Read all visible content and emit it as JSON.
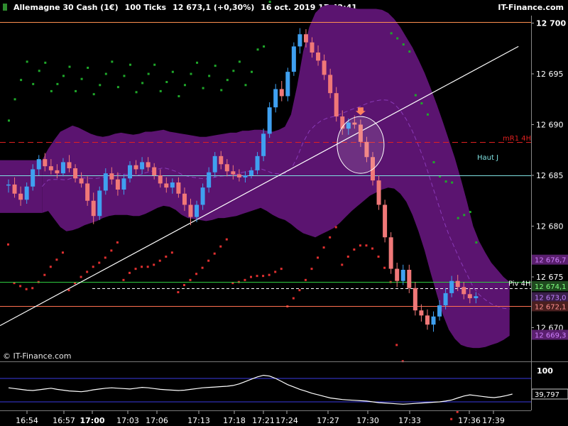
{
  "header": {
    "instrument": "Allemagne 30 Cash (1€)",
    "ticks": "100 Ticks",
    "last": "12 673,1 (+0,30%)",
    "datetime": "16 oct. 2019 17:42:41",
    "brand": "IT-Finance.com"
  },
  "watermark": "© IT-Finance.com",
  "chart_data": [
    {
      "type": "candlestick",
      "ylim": [
        12668,
        12702
      ],
      "y_ticks": [
        {
          "value": 12700,
          "label": "12 700"
        },
        {
          "value": 12695,
          "label": "12 695"
        },
        {
          "value": 12690,
          "label": "12 690"
        },
        {
          "value": 12685,
          "label": "12 685"
        },
        {
          "value": 12680,
          "label": "12 680"
        },
        {
          "value": 12675,
          "label": "12 675"
        },
        {
          "value": 12670,
          "label": "12 670"
        }
      ],
      "x_labels": [
        "16:54",
        "16:57",
        "17:00",
        "17:03",
        "17:06",
        "17:13",
        "17:18",
        "17:21",
        "17:24",
        "17:27",
        "17:30",
        "17:33",
        "17:36",
        "17:39"
      ],
      "bold_x_label": "17:00",
      "levels": [
        {
          "name": "mR1 4H",
          "value": 12688.3,
          "color": "#e02020",
          "style": "dashed"
        },
        {
          "name": "Haut J",
          "value": 12685.0,
          "color": "#7fe0e0",
          "style": "solid"
        },
        {
          "name": "Piv 4H",
          "value": 12673.9,
          "color": "#ffffff",
          "style": "dashed"
        },
        {
          "name": "",
          "value": 12674.5,
          "color": "#2ecc40",
          "style": "solid"
        },
        {
          "name": "",
          "value": 12672.1,
          "color": "#ff7050",
          "style": "solid"
        },
        {
          "name": "",
          "value": 12700.1,
          "color": "#ff9050",
          "style": "solid"
        }
      ],
      "price_tags": [
        {
          "label": "12 676,7",
          "value": 12676.7,
          "bg": "#5a1f6e",
          "fg": "#d080ff"
        },
        {
          "label": "12 674,1",
          "value": 12674.1,
          "bg": "#1f4a1f",
          "fg": "#7fff7f"
        },
        {
          "label": "12 673,0",
          "value": 12673.0,
          "bg": "#3a1f4a",
          "fg": "#c080ff"
        },
        {
          "label": "12 672,1",
          "value": 12672.1,
          "bg": "#4a1f1f",
          "fg": "#ff9090"
        },
        {
          "label": "12 669,3",
          "value": 12669.3,
          "bg": "#5a1f6e",
          "fg": "#d080ff"
        }
      ],
      "candles": [
        [
          12684.0,
          12684.6,
          12683.3,
          12684.1
        ],
        [
          12684.1,
          12684.8,
          12682.8,
          12683.2
        ],
        [
          12683.2,
          12683.9,
          12682.0,
          12682.6
        ],
        [
          12682.6,
          12684.3,
          12682.2,
          12683.9
        ],
        [
          12683.9,
          12686.1,
          12683.5,
          12685.6
        ],
        [
          12685.6,
          12687.0,
          12685.0,
          12686.6
        ],
        [
          12686.6,
          12687.2,
          12685.4,
          12685.9
        ],
        [
          12685.9,
          12686.6,
          12685.1,
          12685.5
        ],
        [
          12685.5,
          12686.1,
          12684.7,
          12685.2
        ],
        [
          12685.2,
          12686.7,
          12684.9,
          12686.3
        ],
        [
          12686.3,
          12687.0,
          12685.3,
          12685.7
        ],
        [
          12685.7,
          12686.1,
          12684.3,
          12684.7
        ],
        [
          12684.7,
          12685.3,
          12683.8,
          12684.2
        ],
        [
          12684.2,
          12684.9,
          12682.0,
          12682.5
        ],
        [
          12682.5,
          12683.3,
          12680.2,
          12681.0
        ],
        [
          12681.0,
          12683.9,
          12680.6,
          12683.5
        ],
        [
          12683.5,
          12685.7,
          12683.1,
          12685.2
        ],
        [
          12685.2,
          12685.8,
          12684.1,
          12684.6
        ],
        [
          12684.6,
          12685.3,
          12683.0,
          12683.6
        ],
        [
          12683.6,
          12685.1,
          12683.1,
          12684.7
        ],
        [
          12684.7,
          12686.4,
          12684.3,
          12686.0
        ],
        [
          12686.0,
          12686.5,
          12685.1,
          12685.6
        ],
        [
          12685.6,
          12686.8,
          12685.1,
          12686.3
        ],
        [
          12686.3,
          12686.8,
          12685.4,
          12685.8
        ],
        [
          12685.8,
          12686.2,
          12684.6,
          12685.0
        ],
        [
          12685.0,
          12685.6,
          12683.8,
          12684.2
        ],
        [
          12684.2,
          12684.8,
          12683.3,
          12683.8
        ],
        [
          12683.8,
          12684.7,
          12683.2,
          12684.3
        ],
        [
          12684.3,
          12684.8,
          12682.8,
          12683.2
        ],
        [
          12683.2,
          12683.8,
          12681.5,
          12682.1
        ],
        [
          12682.1,
          12682.7,
          12680.1,
          12680.9
        ],
        [
          12680.9,
          12682.5,
          12680.4,
          12682.1
        ],
        [
          12682.1,
          12684.2,
          12681.6,
          12683.8
        ],
        [
          12683.8,
          12685.8,
          12683.3,
          12685.3
        ],
        [
          12685.3,
          12687.3,
          12684.8,
          12686.9
        ],
        [
          12686.9,
          12687.4,
          12685.6,
          12686.1
        ],
        [
          12686.1,
          12686.6,
          12684.9,
          12685.4
        ],
        [
          12685.4,
          12686.0,
          12684.6,
          12685.1
        ],
        [
          12685.1,
          12685.6,
          12684.4,
          12684.8
        ],
        [
          12684.8,
          12685.4,
          12684.3,
          12685.0
        ],
        [
          12685.0,
          12685.8,
          12684.7,
          12685.5
        ],
        [
          12685.5,
          12687.3,
          12685.1,
          12686.9
        ],
        [
          12686.9,
          12689.6,
          12686.4,
          12689.1
        ],
        [
          12689.1,
          12692.2,
          12688.7,
          12691.7
        ],
        [
          12691.7,
          12694.0,
          12691.2,
          12693.5
        ],
        [
          12693.5,
          12694.3,
          12692.3,
          12692.8
        ],
        [
          12692.8,
          12695.6,
          12692.3,
          12695.2
        ],
        [
          12695.2,
          12698.1,
          12694.8,
          12697.7
        ],
        [
          12697.7,
          12699.5,
          12697.0,
          12698.9
        ],
        [
          12698.9,
          12699.4,
          12697.6,
          12698.1
        ],
        [
          12698.1,
          12698.6,
          12696.6,
          12697.1
        ],
        [
          12697.1,
          12697.8,
          12695.8,
          12696.3
        ],
        [
          12696.3,
          12696.9,
          12694.4,
          12694.9
        ],
        [
          12694.9,
          12695.5,
          12692.6,
          12693.1
        ],
        [
          12693.1,
          12693.7,
          12690.3,
          12690.8
        ],
        [
          12690.8,
          12691.4,
          12689.0,
          12689.6
        ],
        [
          12689.6,
          12690.6,
          12689.0,
          12690.2
        ],
        [
          12690.2,
          12690.9,
          12689.6,
          12690.0
        ],
        [
          12690.0,
          12690.5,
          12687.8,
          12688.3
        ],
        [
          12688.3,
          12688.8,
          12686.3,
          12686.8
        ],
        [
          12686.8,
          12687.3,
          12684.0,
          12684.5
        ],
        [
          12684.5,
          12685.0,
          12681.6,
          12682.1
        ],
        [
          12682.1,
          12682.6,
          12678.4,
          12678.9
        ],
        [
          12678.9,
          12679.4,
          12675.3,
          12675.8
        ],
        [
          12675.8,
          12676.4,
          12674.0,
          12674.6
        ],
        [
          12674.6,
          12676.2,
          12674.2,
          12675.7
        ],
        [
          12675.7,
          12676.2,
          12673.4,
          12673.9
        ],
        [
          12673.9,
          12674.5,
          12671.2,
          12671.7
        ],
        [
          12671.7,
          12672.3,
          12670.6,
          12671.2
        ],
        [
          12671.2,
          12671.8,
          12669.8,
          12670.3
        ],
        [
          12670.3,
          12671.6,
          12669.6,
          12671.1
        ],
        [
          12671.1,
          12672.7,
          12670.7,
          12672.2
        ],
        [
          12672.2,
          12673.9,
          12671.8,
          12673.4
        ],
        [
          12673.4,
          12675.1,
          12673.0,
          12674.6
        ],
        [
          12674.6,
          12675.2,
          12673.6,
          12674.0
        ],
        [
          12674.0,
          12674.5,
          12672.8,
          12673.3
        ],
        [
          12673.3,
          12673.9,
          12672.4,
          12672.9
        ],
        [
          12672.9,
          12673.5,
          12672.4,
          12673.1
        ]
      ],
      "band_upper": [
        12686.5,
        12687.6,
        12688.5,
        12689.3,
        12689.6,
        12689.9,
        12689.7,
        12689.4,
        12689.1,
        12688.9,
        12688.8,
        12688.9,
        12689.1,
        12689.2,
        12689.1,
        12689.0,
        12689.1,
        12689.3,
        12689.3,
        12689.4,
        12689.5,
        12689.3,
        12689.2,
        12689.1,
        12689.0,
        12688.9,
        12688.8,
        12688.8,
        12688.9,
        12689.0,
        12689.1,
        12689.2,
        12689.2,
        12689.4,
        12689.4,
        12689.5,
        12689.5,
        12689.4,
        12689.3,
        12689.5,
        12689.8,
        12691.0,
        12693.8,
        12697.2,
        12699.6,
        12701.0,
        12701.6,
        12701.8,
        12701.8,
        12701.7,
        12701.6,
        12701.5,
        12701.4,
        12701.4,
        12701.4,
        12701.4,
        12701.3,
        12701.0,
        12700.4,
        12699.6,
        12698.6,
        12697.6,
        12696.4,
        12695.1,
        12693.6,
        12692.0,
        12690.3,
        12688.5,
        12686.7,
        12684.6,
        12682.4,
        12680.0,
        12678.5,
        12677.4,
        12676.4,
        12675.7,
        12675.0,
        12674.5
      ],
      "band_lower": [
        12681.3,
        12681.5,
        12680.7,
        12679.9,
        12679.5,
        12679.6,
        12679.8,
        12680.1,
        12680.3,
        12680.5,
        12680.8,
        12681.0,
        12681.1,
        12681.1,
        12681.1,
        12681.0,
        12681.0,
        12681.2,
        12681.5,
        12681.8,
        12682.0,
        12681.9,
        12681.6,
        12681.1,
        12680.8,
        12680.7,
        12680.6,
        12680.5,
        12680.6,
        12680.8,
        12680.8,
        12680.9,
        12681.0,
        12681.2,
        12681.4,
        12681.6,
        12681.8,
        12681.5,
        12681.1,
        12680.8,
        12680.6,
        12680.2,
        12679.7,
        12679.3,
        12679.1,
        12678.9,
        12679.2,
        12679.5,
        12679.8,
        12680.3,
        12680.9,
        12681.5,
        12682.0,
        12682.5,
        12683.0,
        12683.3,
        12683.6,
        12683.8,
        12683.7,
        12683.2,
        12682.4,
        12681.1,
        12679.5,
        12677.6,
        12675.4,
        12673.3,
        12671.3,
        12669.8,
        12668.9,
        12668.3,
        12668.1,
        12668.0,
        12668.0,
        12668.1,
        12668.3,
        12668.5,
        12668.8,
        12669.2
      ],
      "trend_line": {
        "from": [
          0,
          12670.2
        ],
        "to": [
          84,
          12697.7
        ],
        "color": "#ffffff"
      },
      "markers": {
        "arrow": {
          "index": 58,
          "value": 12691.7,
          "color": "#ff8060"
        },
        "circle": {
          "index": 58,
          "value": 12688.0
        }
      }
    },
    {
      "type": "line",
      "name": "oscillator",
      "ylim": [
        0,
        120
      ],
      "y_ticks": [
        {
          "value": 100,
          "label": "100"
        }
      ],
      "levels": [
        80,
        20
      ],
      "last_value_label": "39,797",
      "values": [
        56,
        54,
        52,
        50,
        49,
        51,
        53,
        55,
        52,
        50,
        48,
        47,
        46,
        48,
        51,
        53,
        55,
        56,
        55,
        54,
        53,
        55,
        57,
        56,
        54,
        52,
        51,
        50,
        49,
        50,
        52,
        54,
        56,
        57,
        58,
        59,
        60,
        62,
        66,
        72,
        78,
        84,
        88,
        86,
        80,
        72,
        64,
        58,
        52,
        47,
        42,
        38,
        34,
        30,
        28,
        26,
        25,
        24,
        23,
        22,
        20,
        18,
        17,
        16,
        15,
        14,
        15,
        16,
        17,
        18,
        19,
        20,
        22,
        25,
        30,
        35,
        38,
        36,
        34,
        32,
        31,
        33,
        36,
        40
      ]
    }
  ]
}
